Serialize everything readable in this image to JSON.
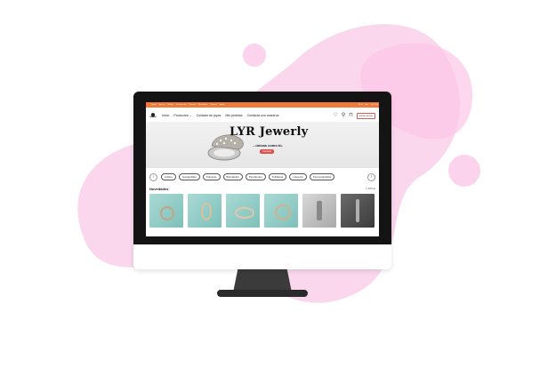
{
  "colors": {
    "menubar": "#f07a3a",
    "accent": "#d9534f",
    "blob": "#fbd3ec",
    "product_teal": "#a9d9d4"
  },
  "menubar": {
    "items": [
      "Finder",
      "Archivo",
      "Edición",
      "Visualización",
      "Historial",
      "Marcadores",
      "Ventana",
      "Ayuda"
    ],
    "right": [
      "Wi-Fi",
      "Bat",
      "Vie 12:00"
    ]
  },
  "nav": {
    "logo_icon": "lyr-logo-icon",
    "links": [
      {
        "label": "Inicio"
      },
      {
        "label": "Productos",
        "has_chevron": true
      },
      {
        "label": "Cuidado de joyas"
      },
      {
        "label": "Mis pedidos"
      },
      {
        "label": "Contacta con nosotros"
      }
    ],
    "icons": [
      "heart-icon",
      "search-icon",
      "bag-icon"
    ],
    "login_label": "Iniciar sesión"
  },
  "hero": {
    "title": "LYR Jewerly",
    "subtitle": "...únicas como tú.",
    "button_label": "Comprar"
  },
  "categories": {
    "prev_icon": "chevron-left-icon",
    "next_icon": "chevron-right-icon",
    "items": [
      "Anillos",
      "Gargantillas",
      "Pulseras",
      "Brazaletes",
      "Pendientes",
      "Tobilleras",
      "Llaveros",
      "Personalizadas"
    ]
  },
  "novedades": {
    "title": "Novedades",
    "more_label": "Filtros",
    "products": [
      {
        "style": "teal"
      },
      {
        "style": "teal"
      },
      {
        "style": "teal"
      },
      {
        "style": "teal"
      },
      {
        "style": "grey"
      },
      {
        "style": "dark"
      }
    ]
  }
}
